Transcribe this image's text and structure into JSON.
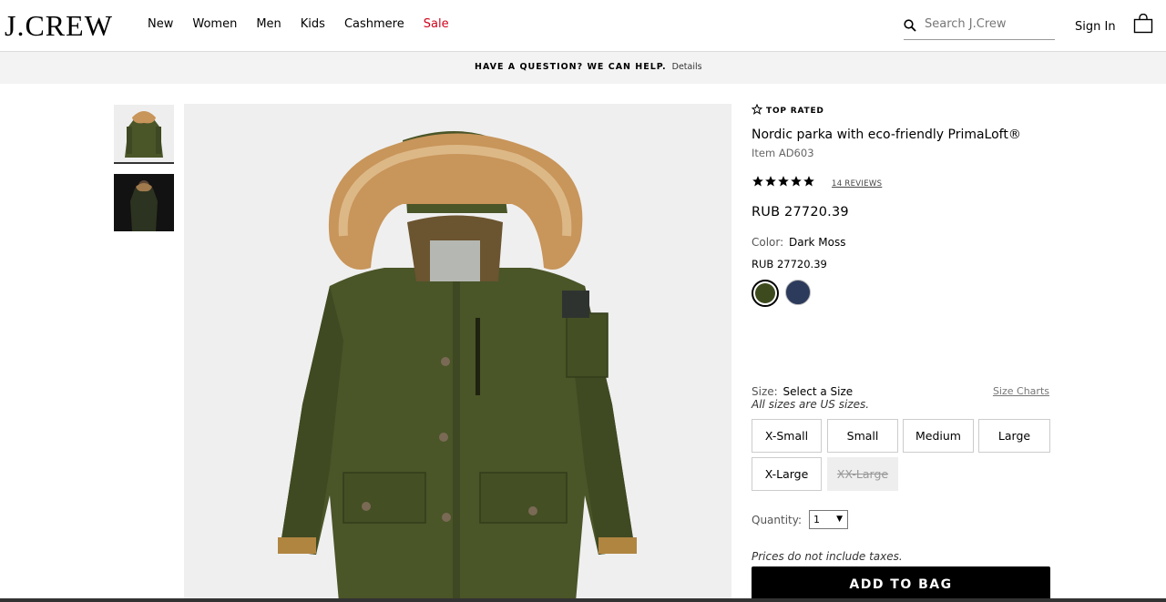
{
  "header": {
    "logo": "J.CREW",
    "nav": [
      "New",
      "Women",
      "Men",
      "Kids",
      "Cashmere",
      "Sale"
    ],
    "search_placeholder": "Search J.Crew",
    "sign_in": "Sign In"
  },
  "promo": {
    "text": "HAVE A QUESTION? WE CAN HELP.",
    "link": "Details"
  },
  "product": {
    "badge": "TOP RATED",
    "name": "Nordic parka with eco-friendly PrimaLoft®",
    "item_no": "Item AD603",
    "rating": 5,
    "reviews": "14 REVIEWS",
    "price": "RUB 27720.39",
    "color_label": "Color:",
    "color_value": "Dark Moss",
    "color_price": "RUB 27720.39",
    "swatches": [
      {
        "name": "Dark Moss",
        "color": "#3d4a1e",
        "selected": true
      },
      {
        "name": "Navy",
        "color": "#2c3a5c",
        "selected": false
      }
    ],
    "size_label": "Size:",
    "size_value": "Select a Size",
    "size_charts": "Size Charts",
    "size_note": "All sizes are US sizes.",
    "sizes": [
      {
        "label": "X-Small",
        "available": true
      },
      {
        "label": "Small",
        "available": true
      },
      {
        "label": "Medium",
        "available": true
      },
      {
        "label": "Large",
        "available": true
      },
      {
        "label": "X-Large",
        "available": true
      },
      {
        "label": "XX-Large",
        "available": false
      }
    ],
    "quantity_label": "Quantity:",
    "quantity_value": "1",
    "taxes_note": "Prices do not include taxes.",
    "add_to_bag": "ADD TO BAG"
  },
  "colors": {
    "sale": "#d0021b",
    "parka": "#4a5528",
    "fur": "#c8955a"
  }
}
